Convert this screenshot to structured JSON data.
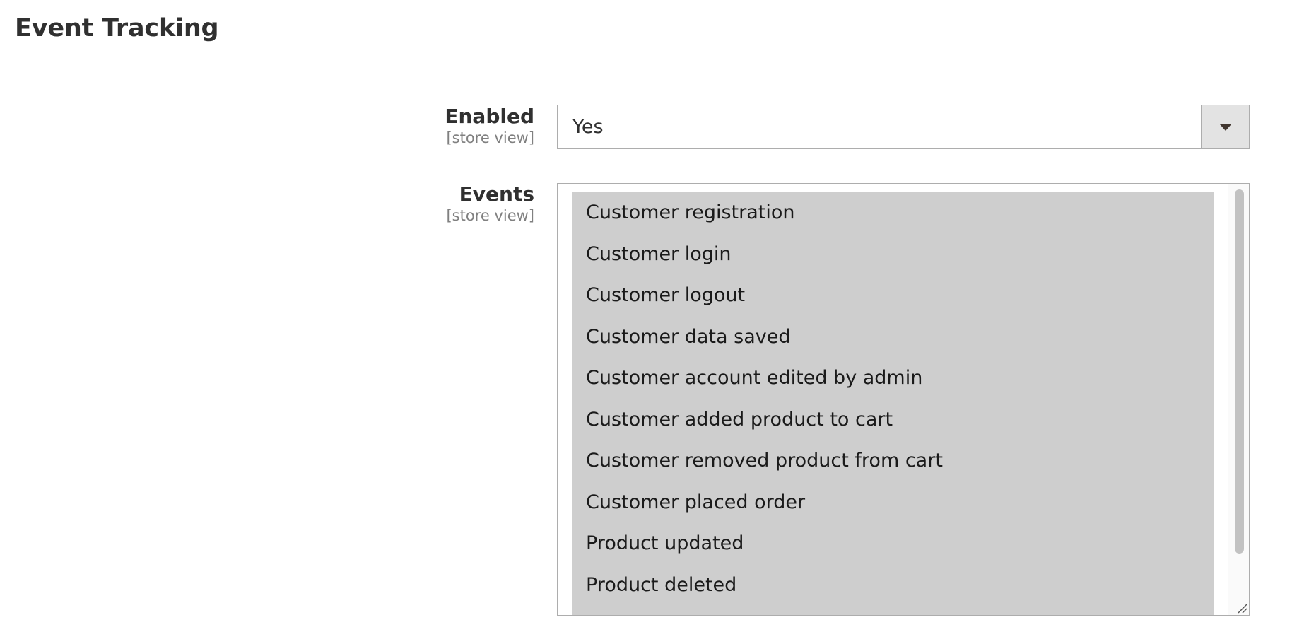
{
  "section": {
    "title": "Event Tracking"
  },
  "fields": {
    "enabled": {
      "label": "Enabled",
      "scope": "[store view]",
      "value": "Yes"
    },
    "events": {
      "label": "Events",
      "scope": "[store view]",
      "options": [
        "Customer registration",
        "Customer login",
        "Customer logout",
        "Customer data saved",
        "Customer account edited by admin",
        "Customer added product to cart",
        "Customer removed product from cart",
        "Customer placed order",
        "Product updated",
        "Product deleted"
      ]
    }
  },
  "icons": {
    "dropdown": "chevron-down-icon",
    "resize": "resize-grip-icon"
  },
  "colors": {
    "selected_option_bg": "#cecece",
    "border": "#adadad",
    "dropdown_button_bg": "#e3e3e3"
  }
}
